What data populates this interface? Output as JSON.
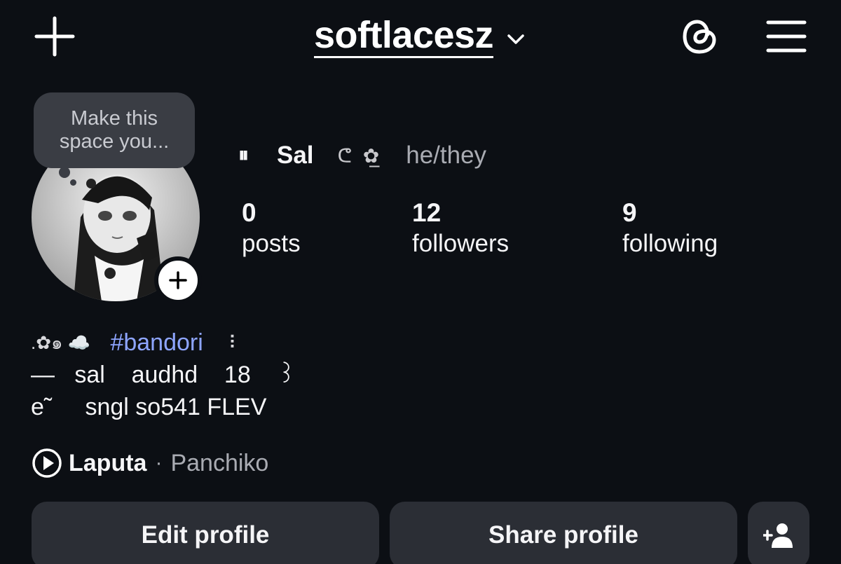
{
  "header": {
    "username": "softlacesz",
    "icons": [
      "plus-icon",
      "chevron-down-icon",
      "threads-icon",
      "hamburger-menu-icon"
    ]
  },
  "tooltip": {
    "text": "Make this space you..."
  },
  "profile": {
    "pause_glyph": "⏸",
    "display_name": "Sal",
    "name_decoration": "ᕦ ✿̲",
    "pronouns": "he/they"
  },
  "stats": {
    "posts": {
      "count": "0",
      "label": "posts"
    },
    "followers": {
      "count": "12",
      "label": "followers"
    },
    "following": {
      "count": "9",
      "label": "following"
    }
  },
  "bio": {
    "line1_deco": ".✿๑ ☁️",
    "line1_hashtag": "#bandori",
    "line1_trail": "⠸",
    "line2": "—   sal    audhd    18    ꒱",
    "line3_deco": "e˜",
    "line3": "sngl so541 FLEV"
  },
  "music": {
    "song": "Laputa",
    "separator": "·",
    "artist": "Panchiko"
  },
  "buttons": {
    "edit_profile": "Edit profile",
    "share_profile": "Share profile"
  },
  "colors": {
    "background": "#0c0f14",
    "button_bg": "#2b2e35",
    "tooltip_bg": "#3a3d44",
    "hashtag": "#8ea5ff",
    "muted_text": "#a9abb2"
  }
}
